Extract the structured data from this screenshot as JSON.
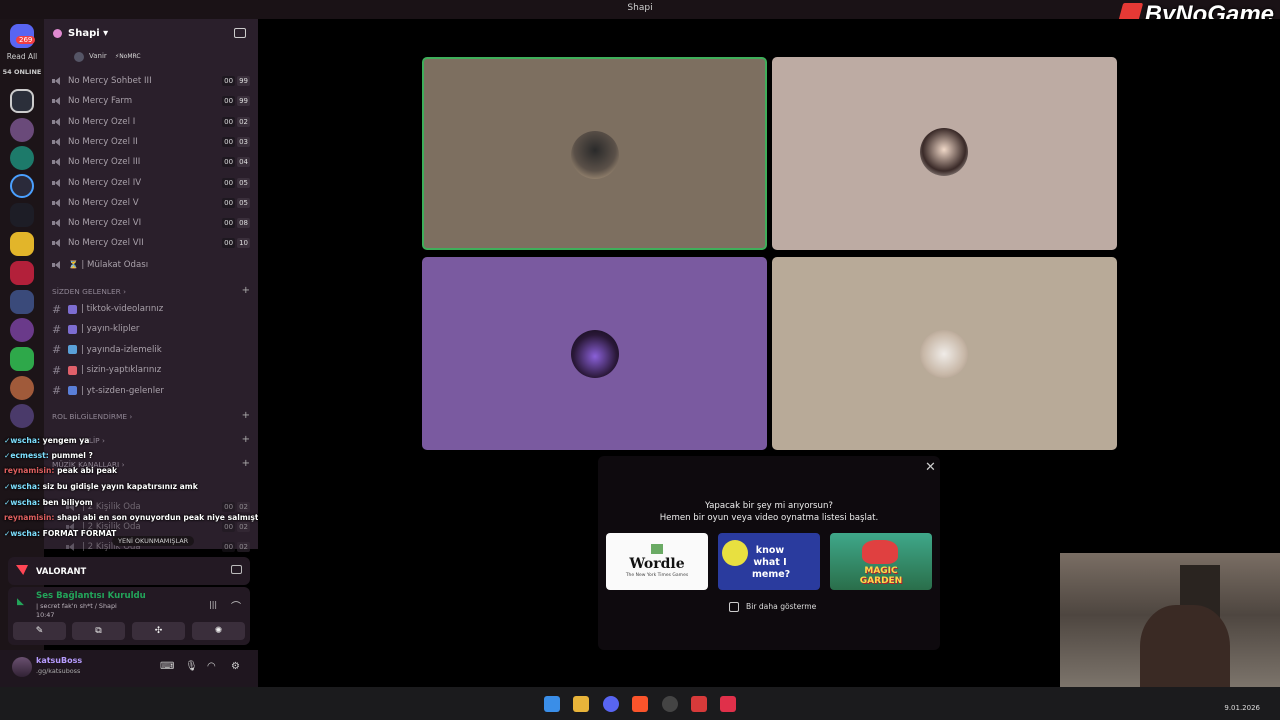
{
  "window": {
    "title": "Shapi"
  },
  "brand": {
    "name": "ByNoGame"
  },
  "guildbar": {
    "unread": "269",
    "read_all": "Read All",
    "online": "54 ONLINE"
  },
  "server": {
    "name": "Shapi"
  },
  "voice_user": {
    "name": "Vanir",
    "tag": "⚡NoMRC"
  },
  "voice_channels": [
    {
      "name": "No Mercy Sohbet III",
      "count": "00",
      "limit": "99"
    },
    {
      "name": "No Mercy Farm",
      "count": "00",
      "limit": "99"
    },
    {
      "name": "No Mercy Özel I",
      "count": "00",
      "limit": "02"
    },
    {
      "name": "No Mercy Özel II",
      "count": "00",
      "limit": "03"
    },
    {
      "name": "No Mercy Özel III",
      "count": "00",
      "limit": "04"
    },
    {
      "name": "No Mercy Özel IV",
      "count": "00",
      "limit": "05"
    },
    {
      "name": "No Mercy Özel V",
      "count": "00",
      "limit": "05"
    },
    {
      "name": "No Mercy Özel VI",
      "count": "00",
      "limit": "08"
    },
    {
      "name": "No Mercy Özel VII",
      "count": "00",
      "limit": "10"
    }
  ],
  "mulakat": {
    "name": "⏳ | Mülakat Odası"
  },
  "categories": {
    "sizden": "SİZDEN GELENLER",
    "rol": "ROL BİLGİLENDİRME",
    "klip": "KLİP",
    "muzik": "MÜZİK KANALLARI"
  },
  "text_channels": [
    {
      "name": "| tiktok-videolarınız",
      "color": "#7d6dd1"
    },
    {
      "name": "| yayın-klipler",
      "color": "#7d6dd1"
    },
    {
      "name": "| yayında-izlemelik",
      "color": "#5aa0d8"
    },
    {
      "name": "| sizin-yaptıklarınız",
      "color": "#e0606a"
    },
    {
      "name": "| yt-sizden-gelenler",
      "color": "#5a7fd8"
    }
  ],
  "lower_rooms": [
    {
      "name": "| 2 Kişilik Oda",
      "count": "00",
      "limit": "02"
    },
    {
      "name": "| 2 Kişilik Oda",
      "count": "00",
      "limit": "02"
    },
    {
      "name": "| 2 Kişilik Oda",
      "count": "00",
      "limit": "02"
    }
  ],
  "chat": [
    {
      "user": "wscha:",
      "text": "yengem ya"
    },
    {
      "user": "ecmesst:",
      "text": "pummel ?"
    },
    {
      "user": "reynamisin:",
      "text": "peak abi peak"
    },
    {
      "user": "wscha:",
      "text": "siz bu gidişle yayın kapatırsınız amk"
    },
    {
      "user": "wscha:",
      "text": "ben biliyom"
    },
    {
      "user": "reynamisin:",
      "text": "shapi abi en son oynuyordun peak niye salmıştık"
    },
    {
      "user": "wscha:",
      "text": "FORMAT FORMAT"
    }
  ],
  "unread_pill": "YENİ OKUNMAMIŞLAR",
  "game": {
    "title": "VALORANT"
  },
  "voice": {
    "status": "Ses Bağlantısı Kuruldu",
    "channel": "| secret fak'n sh*t / Shapi",
    "time": "10:47"
  },
  "user": {
    "name": "katsuBoss",
    "status": ".gg/katsuboss"
  },
  "popup": {
    "line1": "Yapacak bir şey mi arıyorsun?",
    "line2": "Hemen bir oyun veya video oynatma listesi başlat.",
    "wordle": "Wordle",
    "wordle_sub": "The New York Times Games",
    "meme": "know what I meme?",
    "garden": "MAGIC GARDEN",
    "dont_show": "Bir daha gösterme",
    "close": "✕"
  },
  "taskbar": {
    "date": "9.01.2026"
  },
  "colors": {
    "tile1": "#7d6f60",
    "tile2": "#bdaba3",
    "tile3": "#7a5aa0",
    "tile4": "#b8aa98",
    "speaking_border": "#3fae5a"
  }
}
